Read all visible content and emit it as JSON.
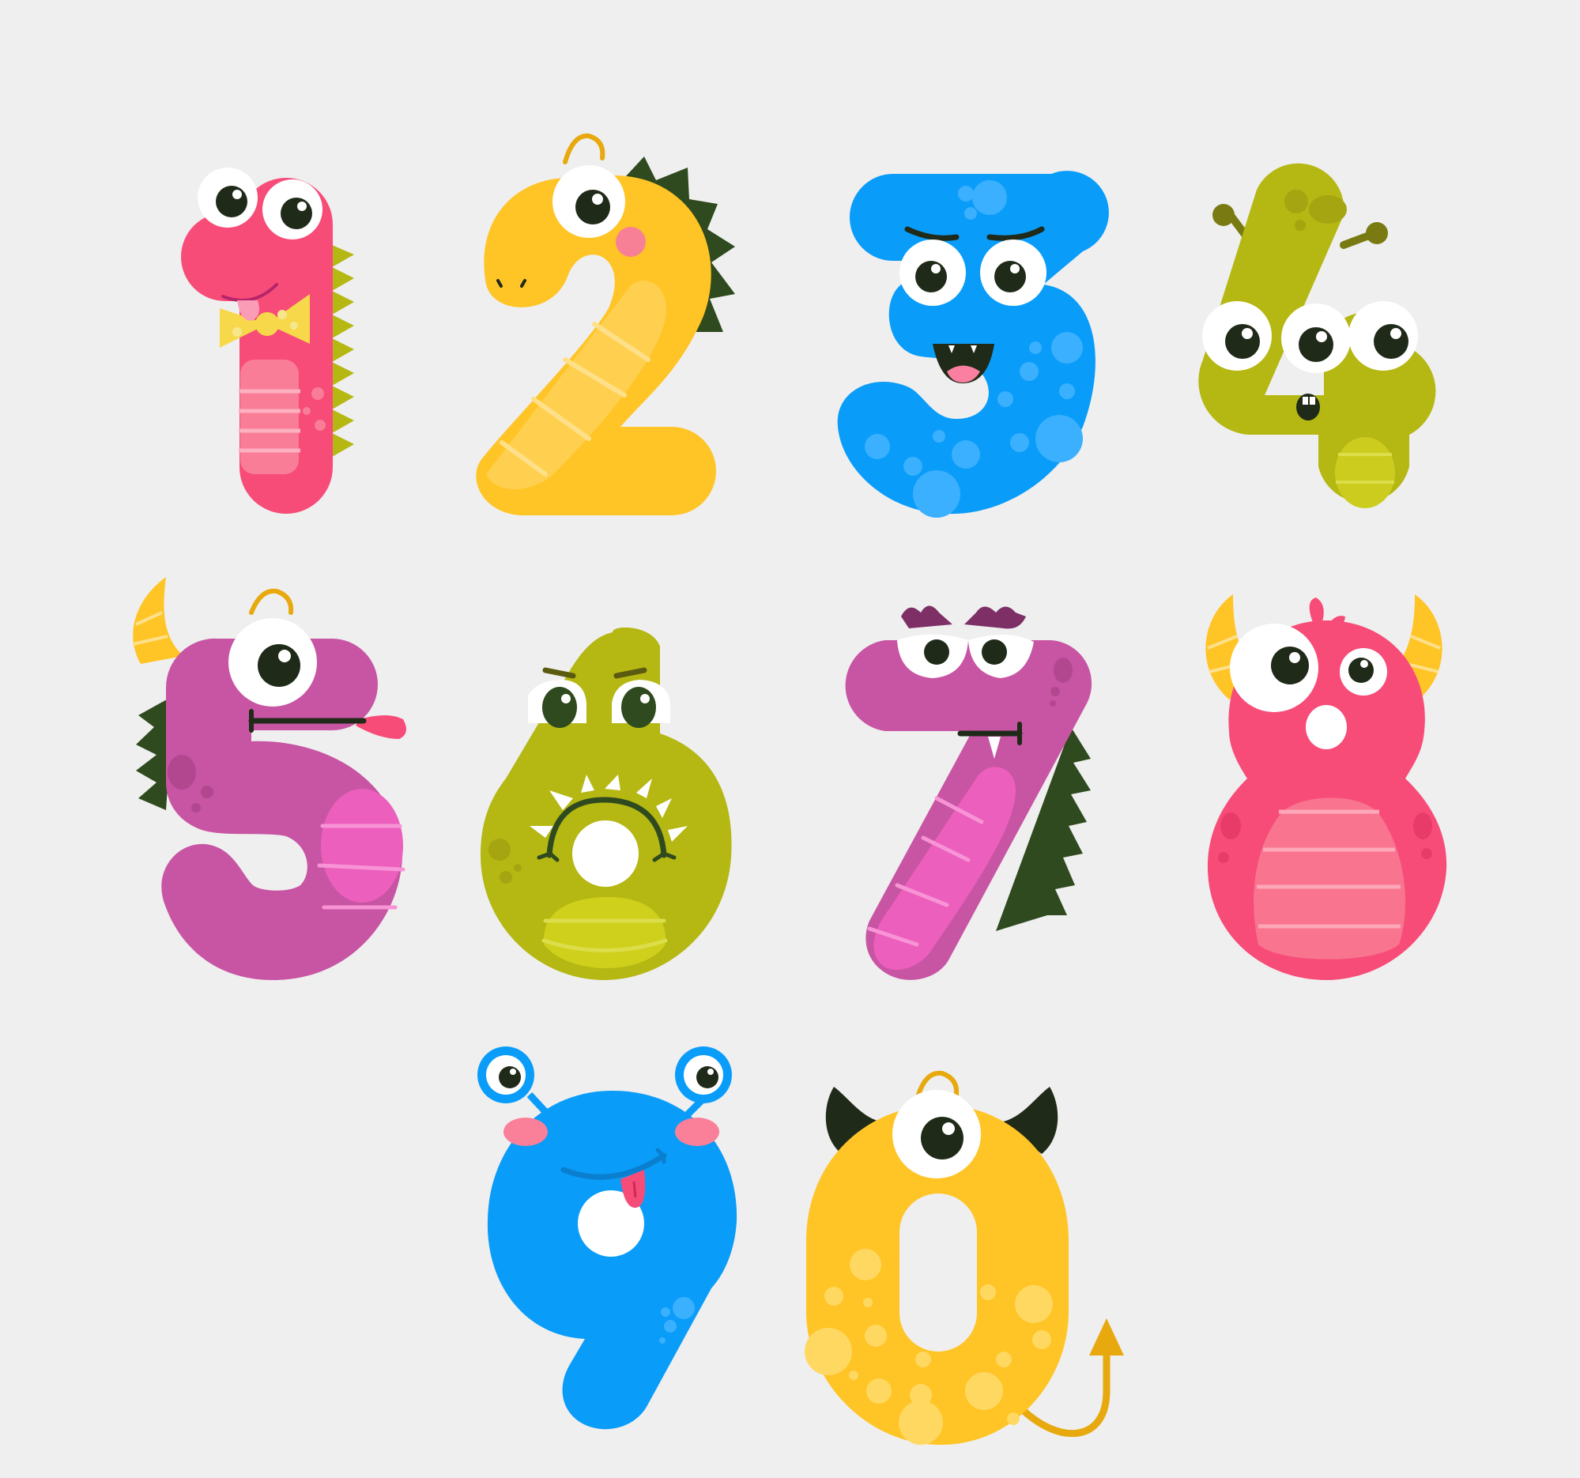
{
  "background_color": "#efefef",
  "colors": {
    "pink": "#f74c78",
    "yellow": "#ffc426",
    "blue": "#0a9cf9",
    "olive": "#b5b713",
    "purple": "#c855a3",
    "dark_spike": "#2e4a1e",
    "eye_pupil": "#1f2a18"
  },
  "monsters": [
    {
      "digit": "1",
      "name": "pink-worm-monster",
      "body_color": "#f74c78"
    },
    {
      "digit": "2",
      "name": "yellow-dragon-monster",
      "body_color": "#ffc426"
    },
    {
      "digit": "3",
      "name": "blue-grinning-monster",
      "body_color": "#0a9cf9"
    },
    {
      "digit": "4",
      "name": "olive-three-eyed-monster",
      "body_color": "#b5b713"
    },
    {
      "digit": "5",
      "name": "purple-horned-monster",
      "body_color": "#c855a3"
    },
    {
      "digit": "6",
      "name": "olive-frog-monster",
      "body_color": "#b5b713"
    },
    {
      "digit": "7",
      "name": "purple-grumpy-monster",
      "body_color": "#c855a3"
    },
    {
      "digit": "8",
      "name": "pink-horned-monster",
      "body_color": "#f74c78"
    },
    {
      "digit": "9",
      "name": "blue-antenna-monster",
      "body_color": "#0a9cf9"
    },
    {
      "digit": "0",
      "name": "yellow-devil-monster",
      "body_color": "#ffc426"
    }
  ]
}
